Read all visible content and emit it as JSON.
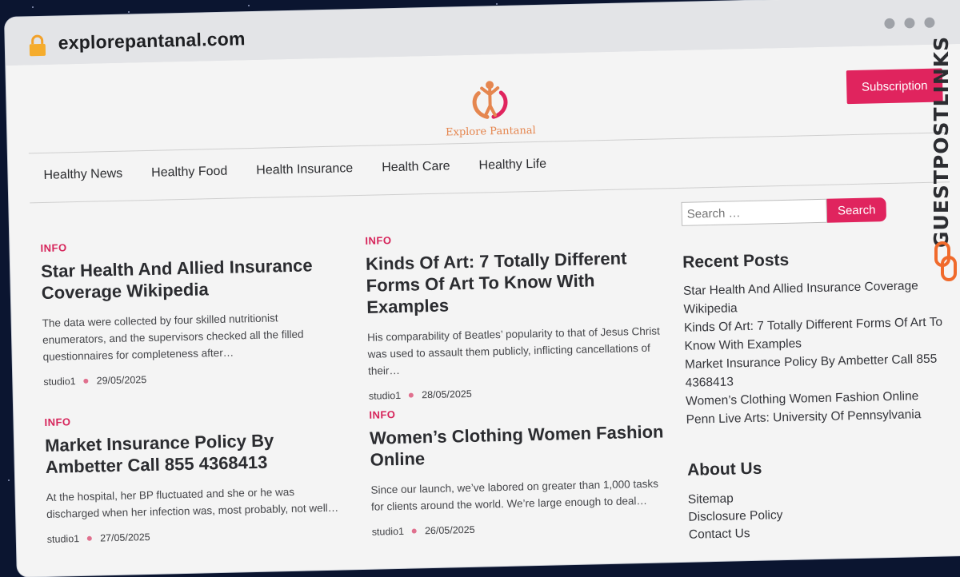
{
  "browser": {
    "url": "explorepantanal.com"
  },
  "header": {
    "logo_text": "Explore Pantanal",
    "subscribe_label": "Subscription"
  },
  "nav": {
    "items": [
      "Healthy News",
      "Healthy Food",
      "Health Insurance",
      "Health Care",
      "Healthy Life"
    ]
  },
  "posts": [
    {
      "category": "INFO",
      "title": "Star Health And Allied Insurance Coverage Wikipedia",
      "excerpt": "The data were collected by four skilled nutritionist enumerators, and the supervisors checked all the filled questionnaires for completeness after…",
      "author": "studio1",
      "date": "29/05/2025"
    },
    {
      "category": "INFO",
      "title": "Kinds Of Art: 7 Totally Different Forms Of Art To Know With Examples",
      "excerpt": "His comparability of Beatles’ popularity to that of Jesus Christ was used to assault them publicly, inflicting cancellations of their…",
      "author": "studio1",
      "date": "28/05/2025"
    },
    {
      "category": "INFO",
      "title": "Market Insurance Policy By Ambetter Call 855 4368413",
      "excerpt": "At the hospital, her BP fluctuated and she or he was discharged when her infection was, most probably, not well…",
      "author": "studio1",
      "date": "27/05/2025"
    },
    {
      "category": "INFO",
      "title": "Women’s Clothing Women Fashion Online",
      "excerpt": "Since our launch, we’ve labored on greater than 1,000 tasks for clients around the world. We’re large enough to deal…",
      "author": "studio1",
      "date": "26/05/2025"
    }
  ],
  "sidebar": {
    "search_placeholder": "Search …",
    "search_button": "Search",
    "recent_title": "Recent Posts",
    "recent_posts": [
      "Star Health And Allied Insurance Coverage Wikipedia",
      "Kinds Of Art: 7 Totally Different Forms Of Art To Know With Examples",
      "Market Insurance Policy By Ambetter Call 855 4368413",
      "Women’s Clothing Women Fashion Online",
      "Penn Live Arts: University Of Pennsylvania"
    ],
    "about_title": "About Us",
    "about_links": [
      "Sitemap",
      "Disclosure Policy",
      "Contact Us"
    ]
  },
  "badge": {
    "text": "GUESTPOSTLINKS"
  },
  "colors": {
    "accent": "#e0245e",
    "logo": "#e5864f",
    "background": "#0b1530"
  }
}
